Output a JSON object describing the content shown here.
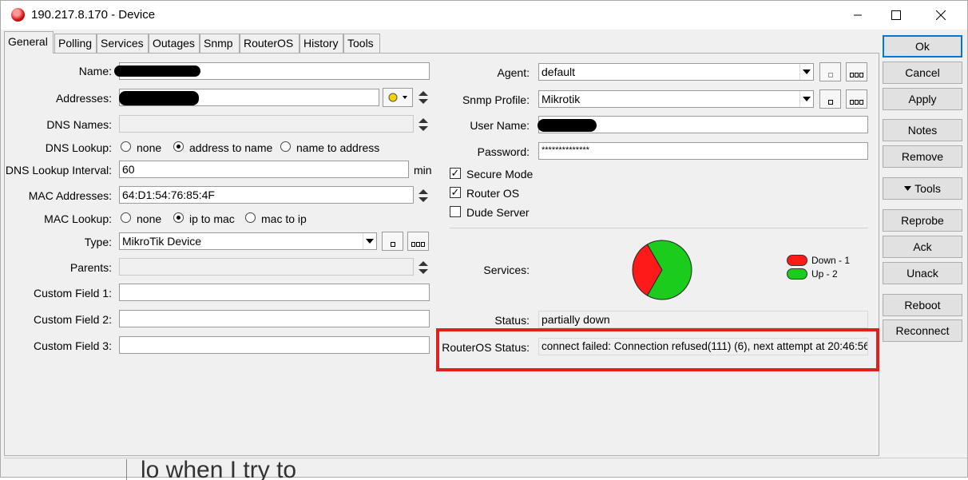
{
  "window": {
    "title": "190.217.8.170 - Device",
    "app_icon": "mikrotik-dude-icon",
    "controls": [
      "minimize-icon",
      "maximize-icon",
      "close-icon"
    ]
  },
  "tabs": [
    {
      "label": "General",
      "active": true
    },
    {
      "label": "Polling"
    },
    {
      "label": "Services"
    },
    {
      "label": "Outages"
    },
    {
      "label": "Snmp"
    },
    {
      "label": "RouterOS"
    },
    {
      "label": "History"
    },
    {
      "label": "Tools"
    }
  ],
  "left": {
    "name_label": "Name:",
    "addresses_label": "Addresses:",
    "dns_names_label": "DNS Names:",
    "dns_lookup_label": "DNS Lookup:",
    "dns_lookup_options": [
      "none",
      "address to name",
      "name to address"
    ],
    "dns_lookup_selected": "address to name",
    "dns_interval_label": "DNS Lookup Interval:",
    "dns_interval_value": "60",
    "dns_interval_unit": "min",
    "mac_addresses_label": "MAC Addresses:",
    "mac_addresses_value": "64:D1:54:76:85:4F",
    "mac_lookup_label": "MAC Lookup:",
    "mac_lookup_options": [
      "none",
      "ip to mac",
      "mac to ip"
    ],
    "mac_lookup_selected": "ip to mac",
    "type_label": "Type:",
    "type_value": "MikroTik Device",
    "parents_label": "Parents:",
    "custom1_label": "Custom Field 1:",
    "custom2_label": "Custom Field 2:",
    "custom3_label": "Custom Field 3:"
  },
  "right": {
    "agent_label": "Agent:",
    "agent_value": "default",
    "snmp_label": "Snmp Profile:",
    "snmp_value": "Mikrotik",
    "username_label": "User Name:",
    "password_label": "Password:",
    "password_value": "**************",
    "secure_mode": "Secure Mode",
    "secure_mode_checked": true,
    "router_os": "Router OS",
    "router_os_checked": true,
    "dude_server": "Dude Server",
    "dude_server_checked": false,
    "services_label": "Services:",
    "status_label": "Status:",
    "status_value": "partially down",
    "routeros_status_label": "RouterOS Status:",
    "routeros_status_value": "connect failed: Connection refused(111) (6), next attempt at 20:46:56"
  },
  "services_chart": {
    "type": "pie",
    "slices": [
      {
        "name": "Down - 1",
        "value": 1,
        "color": "#ff1a1a"
      },
      {
        "name": "Up - 2",
        "value": 2,
        "color": "#1ccc1c"
      }
    ]
  },
  "buttons": [
    "Ok",
    "Cancel",
    "Apply",
    "Notes",
    "Remove",
    "Tools",
    "Reprobe",
    "Ack",
    "Unack",
    "Reboot",
    "Reconnect"
  ],
  "background_text": "lo when I try to",
  "colors": {
    "highlight_box": "#e0201f",
    "default_button_border": "#0078d7"
  }
}
